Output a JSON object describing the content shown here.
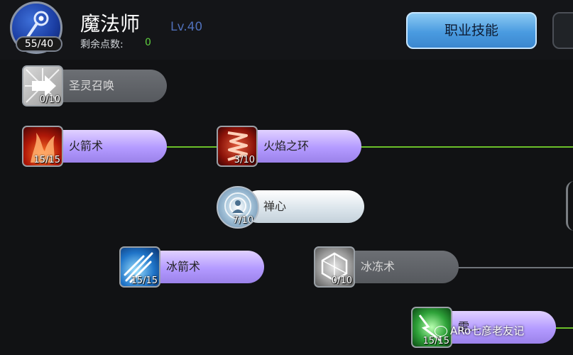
{
  "header": {
    "class_name": "魔法师",
    "level": "Lv.40",
    "skill_points": "55/40",
    "remaining_label": "剩余点数:",
    "remaining_value": "0",
    "job_skills_button": "职业技能"
  },
  "colors": {
    "background": "#111214",
    "connector_active": "#6bc02a",
    "connector_locked": "#6f747a",
    "button_accent": "#4a9be0",
    "learned_pill": "#b39aff",
    "locked_pill": "#5f6267"
  },
  "skills": [
    {
      "name": "圣灵召唤",
      "level": "0/10",
      "icon": "holy-summon-icon",
      "state": "locked"
    },
    {
      "name": "火箭术",
      "level": "15/15",
      "icon": "fire-arrow-icon",
      "state": "learned"
    },
    {
      "name": "火焰之环",
      "level": "3/10",
      "icon": "flame-ring-icon",
      "state": "learned"
    },
    {
      "name": "禅心",
      "level": "7/10",
      "icon": "zen-mind-icon",
      "state": "passive"
    },
    {
      "name": "冰箭术",
      "level": "15/15",
      "icon": "ice-arrow-icon",
      "state": "learned"
    },
    {
      "name": "冰冻术",
      "level": "0/10",
      "icon": "freeze-icon",
      "state": "locked"
    },
    {
      "name": "雷...",
      "level": "15/15",
      "icon": "thunder-icon",
      "state": "learned"
    }
  ],
  "watermark": "ARo七彦老友记"
}
